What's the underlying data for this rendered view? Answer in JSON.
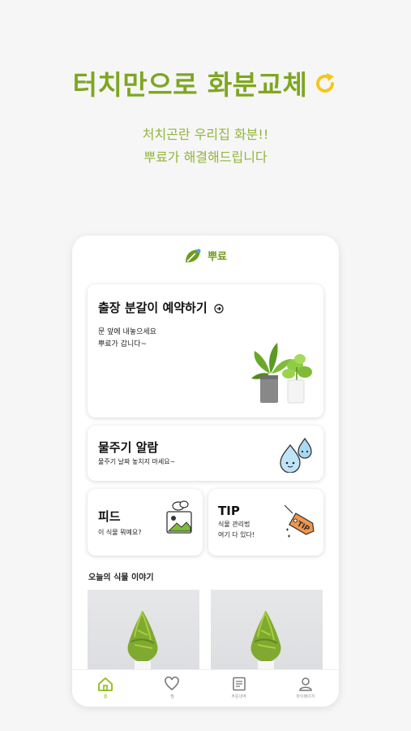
{
  "promo": {
    "headline": "터치만으로 화분교체",
    "sub_line1": "처치곤란 우리집 화분!!",
    "sub_line2": "뿌료가 해결해드립니다"
  },
  "app": {
    "logo_text": "뿌료",
    "cards": {
      "repot": {
        "title": "출장 분갈이 예약하기",
        "desc_line1": "문 앞에 내놓으세요",
        "desc_line2": "뿌료가 갑니다~"
      },
      "water": {
        "title": "물주기 알람",
        "desc": "물주기 날짜 놓치지 마세요~"
      },
      "feed": {
        "title": "피드",
        "desc": "이 식물 뭐예요?"
      },
      "tip": {
        "title": "TIP",
        "desc_line1": "식물 관리법",
        "desc_line2": "여기 다 있다!",
        "tag_text": "TIP"
      }
    },
    "section_title": "오늘의 식물 이야기",
    "tabs": [
      {
        "label": "홈",
        "icon": "home-icon"
      },
      {
        "label": "찜",
        "icon": "heart-icon"
      },
      {
        "label": "주문내역",
        "icon": "document-icon"
      },
      {
        "label": "마이페이지",
        "icon": "user-icon"
      }
    ],
    "colors": {
      "brand_green": "#7fa621",
      "accent_yellow": "#f5c61c",
      "active_tab": "#8bbd14"
    }
  }
}
